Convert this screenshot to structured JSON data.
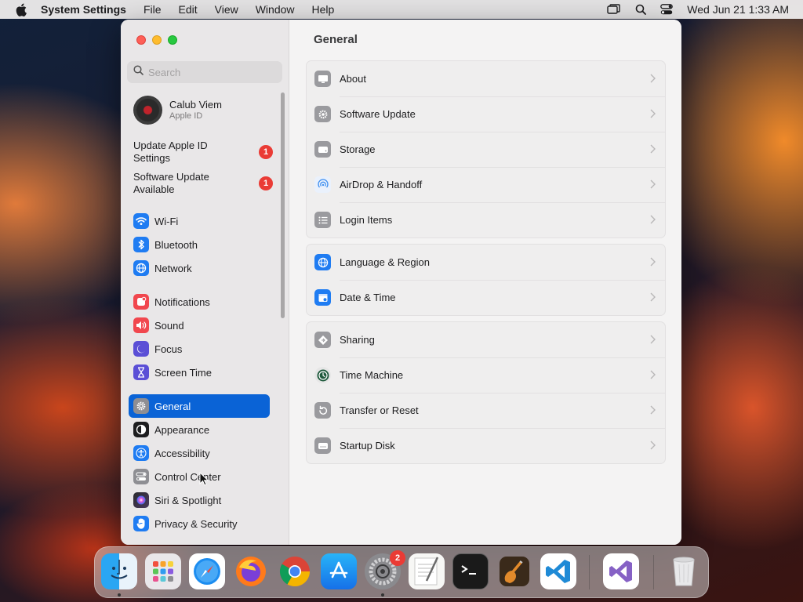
{
  "menubar": {
    "app_name": "System Settings",
    "menus": [
      "File",
      "Edit",
      "View",
      "Window",
      "Help"
    ],
    "clock": "Wed Jun 21  1:33 AM"
  },
  "sidebar": {
    "search_placeholder": "Search",
    "account": {
      "name": "Calub Viem",
      "subtitle": "Apple ID"
    },
    "notices": [
      {
        "label": "Update Apple ID Settings",
        "badge": "1"
      },
      {
        "label": "Software Update Available",
        "badge": "1"
      }
    ],
    "items": [
      {
        "label": "Wi-Fi",
        "icon": "wifi-icon",
        "color": "#1f7cf2"
      },
      {
        "label": "Bluetooth",
        "icon": "bluetooth-icon",
        "color": "#1f7cf2"
      },
      {
        "label": "Network",
        "icon": "globe-icon",
        "color": "#1f7cf2"
      },
      {
        "label": "Notifications",
        "icon": "bell-icon",
        "color": "#f1474e"
      },
      {
        "label": "Sound",
        "icon": "speaker-icon",
        "color": "#f1474e"
      },
      {
        "label": "Focus",
        "icon": "moon-icon",
        "color": "#5b4fd6"
      },
      {
        "label": "Screen Time",
        "icon": "hourglass-icon",
        "color": "#5b4fd6"
      },
      {
        "label": "General",
        "icon": "gear-icon",
        "color": "#8e8e93",
        "active": true
      },
      {
        "label": "Appearance",
        "icon": "appearance-icon",
        "color": "#1d1d1f"
      },
      {
        "label": "Accessibility",
        "icon": "accessibility-icon",
        "color": "#1f7cf2"
      },
      {
        "label": "Control Center",
        "icon": "control-center-icon",
        "color": "#8e8e93"
      },
      {
        "label": "Siri & Spotlight",
        "icon": "siri-icon",
        "color": "#3a3a3c"
      },
      {
        "label": "Privacy & Security",
        "icon": "hand-icon",
        "color": "#1f7cf2"
      }
    ]
  },
  "content": {
    "title": "General",
    "groups": [
      [
        {
          "label": "About",
          "icon": "display-icon"
        },
        {
          "label": "Software Update",
          "icon": "gear-badge-icon"
        },
        {
          "label": "Storage",
          "icon": "disk-icon"
        },
        {
          "label": "AirDrop & Handoff",
          "icon": "airdrop-icon"
        },
        {
          "label": "Login Items",
          "icon": "list-icon"
        }
      ],
      [
        {
          "label": "Language & Region",
          "icon": "globe-icon"
        },
        {
          "label": "Date & Time",
          "icon": "calendar-clock-icon"
        }
      ],
      [
        {
          "label": "Sharing",
          "icon": "sharing-icon"
        },
        {
          "label": "Time Machine",
          "icon": "time-machine-icon"
        },
        {
          "label": "Transfer or Reset",
          "icon": "reset-icon"
        },
        {
          "label": "Startup Disk",
          "icon": "startup-disk-icon"
        }
      ]
    ]
  },
  "dock": {
    "apps": [
      "Finder",
      "Launchpad",
      "Safari",
      "Firefox",
      "Chrome",
      "App Store",
      "System Settings",
      "TextEdit",
      "Terminal",
      "GarageBand",
      "Visual Studio Code",
      "Visual Studio",
      "Trash"
    ],
    "settings_badge": "2"
  }
}
